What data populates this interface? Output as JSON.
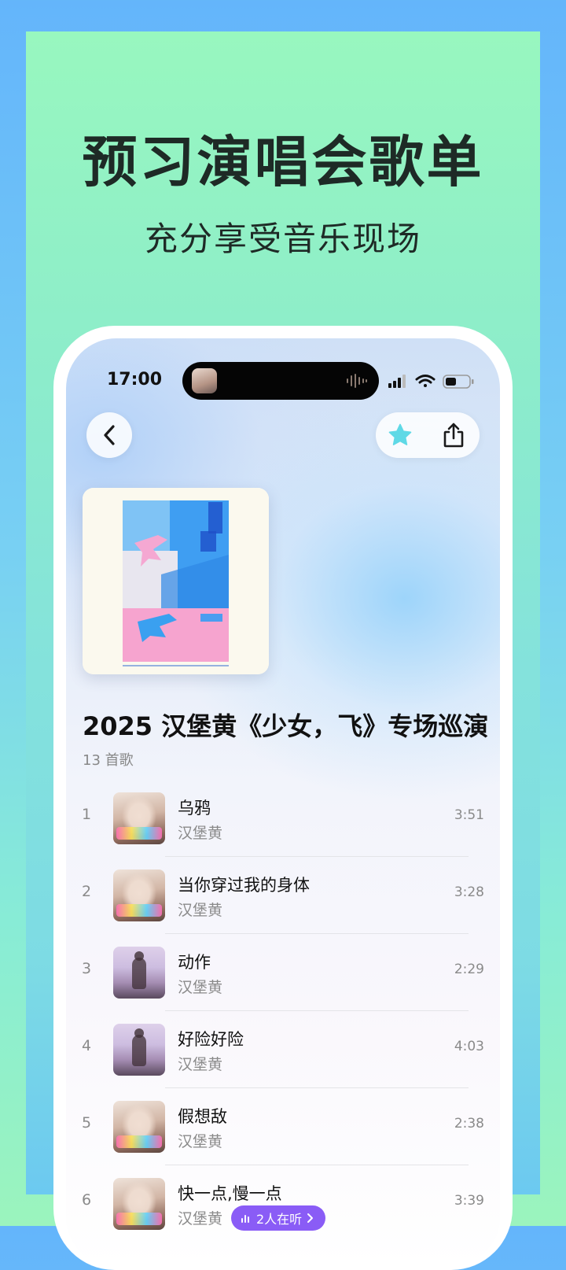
{
  "promo": {
    "headline": "预习演唱会歌单",
    "subline": "充分享受音乐现场"
  },
  "status_bar": {
    "time": "17:00"
  },
  "toolbar": {
    "back_icon": "chevron-left-icon",
    "favorite_icon": "star-icon",
    "share_icon": "share-icon",
    "accent_color": "#5fd9e6"
  },
  "playlist": {
    "title": "2025 汉堡黄《少女，飞》专场巡演",
    "count_label": "13 首歌"
  },
  "tracks": [
    {
      "index": "1",
      "name": "乌鸦",
      "artist": "汉堡黄",
      "duration": "3:51"
    },
    {
      "index": "2",
      "name": "当你穿过我的身体",
      "artist": "汉堡黄",
      "duration": "3:28"
    },
    {
      "index": "3",
      "name": "动作",
      "artist": "汉堡黄",
      "duration": "2:29"
    },
    {
      "index": "4",
      "name": "好险好险",
      "artist": "汉堡黄",
      "duration": "4:03"
    },
    {
      "index": "5",
      "name": "假想敌",
      "artist": "汉堡黄",
      "duration": "2:38"
    },
    {
      "index": "6",
      "name": "快一点,慢一点",
      "artist": "汉堡黄",
      "duration": "3:39"
    }
  ],
  "listening": {
    "label": "2人在听",
    "color": "#8a5cf6"
  }
}
